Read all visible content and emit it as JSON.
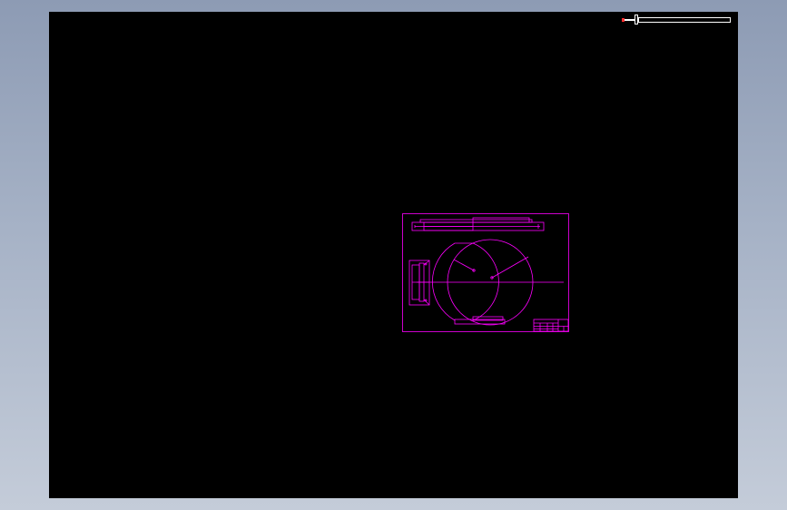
{
  "viewer": {
    "background_colors": [
      "#8d9bb4",
      "#c4ccd9"
    ],
    "canvas_color": "#000000"
  },
  "zoom_slider": {
    "icon": "zoom-slider",
    "value": 0.0
  },
  "drawing": {
    "line_color": "#ff00ff",
    "sheet": "cad-drawing-sheet"
  }
}
